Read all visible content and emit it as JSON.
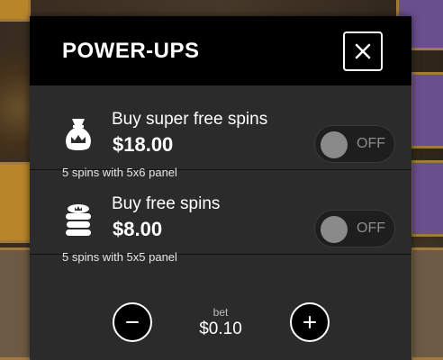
{
  "modal": {
    "title": "POWER-UPS",
    "close_icon": "close-icon"
  },
  "options": [
    {
      "name": "Buy super free spins",
      "price": "$18.00",
      "description": "5 spins with 5x6 panel",
      "toggle_label": "OFF",
      "toggle_on": false,
      "icon": "money-bag-icon"
    },
    {
      "name": "Buy free spins",
      "price": "$8.00",
      "description": "5 spins with 5x5 panel",
      "toggle_label": "OFF",
      "toggle_on": false,
      "icon": "coin-stack-icon"
    }
  ],
  "bet": {
    "label": "bet",
    "value": "$0.10",
    "decrease_icon": "minus-icon",
    "increase_icon": "plus-icon"
  },
  "colors": {
    "panel": "#2b2b2b",
    "header": "#000000",
    "text": "#ffffff",
    "toggle_off": "#8a8a8a"
  }
}
